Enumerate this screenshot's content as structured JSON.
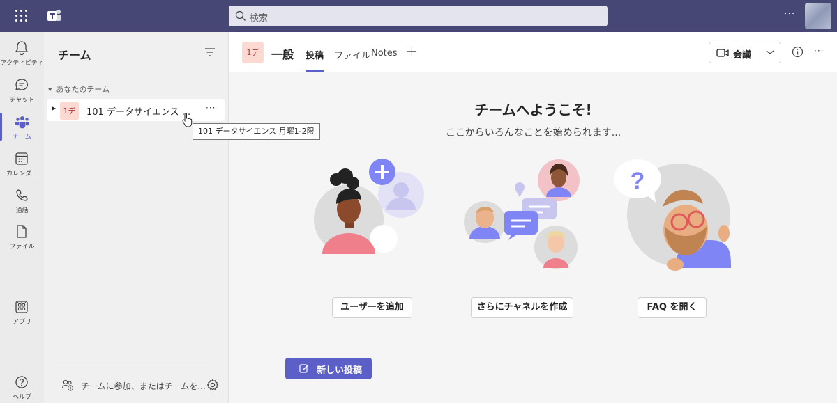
{
  "search": {
    "placeholder": "検索"
  },
  "rail": {
    "items": [
      {
        "label": "アクティビティ"
      },
      {
        "label": "チャット"
      },
      {
        "label": "チーム"
      },
      {
        "label": "カレンダー"
      },
      {
        "label": "通話"
      },
      {
        "label": "ファイル"
      },
      {
        "label": "アプリ"
      },
      {
        "label": "ヘルプ"
      }
    ],
    "more": "···"
  },
  "panel": {
    "title": "チーム",
    "section": "あなたのチーム",
    "team": {
      "avatar": "1デ",
      "name": "101 データサイエンス 月曜1-2限",
      "more": "···"
    },
    "tooltip": "101 データサイエンス 月曜1-2限",
    "join_text": "チームに参加、またはチームを..."
  },
  "channel": {
    "avatar": "1デ",
    "title": "一般",
    "tabs": [
      "投稿",
      "ファイル",
      "Notes"
    ],
    "add": "+",
    "meet_label": "会議",
    "more": "···"
  },
  "welcome": {
    "title": "チームへようこそ!",
    "subtitle": "ここからいろんなことを始められます...",
    "buttons": [
      "ユーザーを追加",
      "さらにチャネルを作成",
      "FAQ を開く"
    ],
    "new_post": "新しい投稿"
  },
  "top": {
    "more": "···"
  },
  "colors": {
    "brand": "#464775",
    "accent": "#5b5fc7",
    "team_avatar_bg": "#fcd9d1",
    "team_avatar_fg": "#a4373a"
  }
}
